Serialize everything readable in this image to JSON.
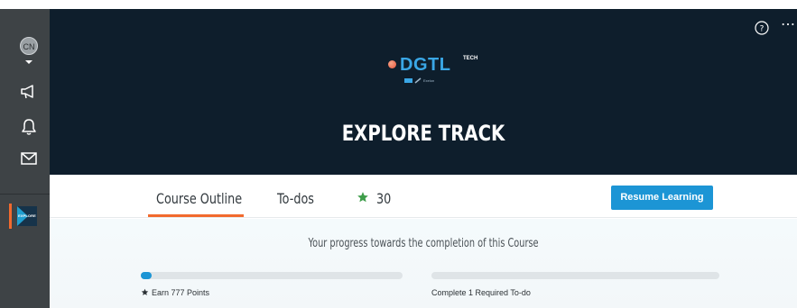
{
  "sidebar": {
    "avatar_initials": "CN",
    "course_thumb_label": "EXPLORE"
  },
  "hero": {
    "logo_word": "DGTL",
    "logo_superscript": "TECH",
    "logo_subtext": "Exelon",
    "title": "EXPLORE TRACK"
  },
  "tabs": {
    "course_outline": "Course Outline",
    "todos": "To-dos",
    "points": "30",
    "resume_button": "Resume Learning"
  },
  "progress": {
    "caption": "Your progress towards the completion of this Course",
    "requirements": [
      {
        "label": "Earn 777 Points",
        "progress_fraction": 0.04
      },
      {
        "label": "Complete 1 Required To-do",
        "progress_fraction": 0.0
      }
    ]
  },
  "icons": [
    "caret-down-icon",
    "megaphone-icon",
    "bell-icon",
    "mail-icon",
    "help-icon",
    "more-icon",
    "star-icon"
  ],
  "colors": {
    "sidebar": "#3e4346",
    "hero": "#0e1e2c",
    "accent_orange": "#f26a2e",
    "accent_blue": "#1c95d5",
    "star_green": "#3e9d4a"
  }
}
